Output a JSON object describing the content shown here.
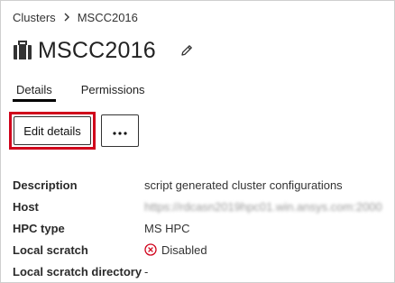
{
  "breadcrumb": {
    "parent": "Clusters",
    "current": "MSCC2016"
  },
  "header": {
    "title": "MSCC2016"
  },
  "tabs": [
    {
      "label": "Details"
    },
    {
      "label": "Permissions"
    }
  ],
  "actions": {
    "edit_label": "Edit details",
    "more_label": "⋯"
  },
  "details": {
    "description": {
      "label": "Description",
      "value": "script generated cluster configurations"
    },
    "host": {
      "label": "Host",
      "value": "https://rdcasn2019hpc01.win.ansys.com:2000"
    },
    "hpc_type": {
      "label": "HPC type",
      "value": "MS HPC"
    },
    "local_scratch": {
      "label": "Local scratch",
      "value": "Disabled"
    },
    "local_scratch_dir": {
      "label": "Local scratch directory",
      "value": "-"
    }
  },
  "colors": {
    "highlight": "#d0021b",
    "disabled_icon": "#d0021b"
  },
  "icons": {
    "briefcase": "briefcase-icon",
    "edit": "pencil-icon",
    "disabled": "x-circle-icon"
  }
}
